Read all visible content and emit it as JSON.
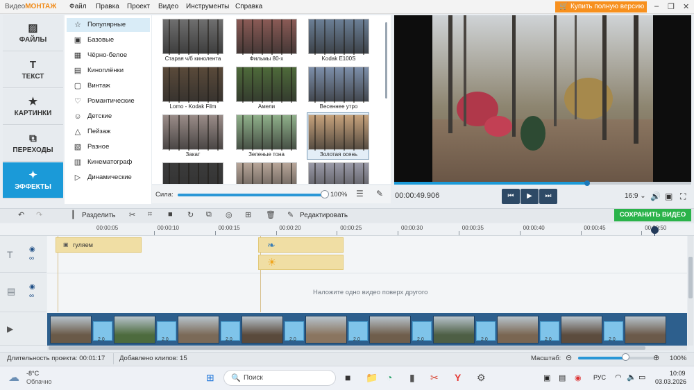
{
  "app": {
    "brand_prefix": "Видео",
    "brand_suffix": "МОНТАЖ",
    "menu": [
      "Файл",
      "Правка",
      "Проект",
      "Видео",
      "Инструменты",
      "Справка"
    ],
    "buy_label": "Купить полную версию"
  },
  "nav": [
    {
      "label": "ФАЙЛЫ",
      "icon": "image-icon",
      "active": false
    },
    {
      "label": "ТЕКСТ",
      "icon": "text-icon",
      "active": false
    },
    {
      "label": "КАРТИНКИ",
      "icon": "star-icon",
      "active": false
    },
    {
      "label": "ПЕРЕХОДЫ",
      "icon": "transition-icon",
      "active": false
    },
    {
      "label": "ЭФФЕКТЫ",
      "icon": "effects-icon",
      "active": true
    }
  ],
  "categories": [
    {
      "label": "Популярные",
      "icon": "star-icon"
    },
    {
      "label": "Базовые",
      "icon": "square-icon"
    },
    {
      "label": "Чёрно-белое",
      "icon": "grid-icon"
    },
    {
      "label": "Киноплёнки",
      "icon": "film-icon"
    },
    {
      "label": "Винтаж",
      "icon": "camera-icon"
    },
    {
      "label": "Романтические",
      "icon": "heart-icon"
    },
    {
      "label": "Детские",
      "icon": "bear-icon"
    },
    {
      "label": "Пейзаж",
      "icon": "mountain-icon"
    },
    {
      "label": "Разное",
      "icon": "blocks-icon"
    },
    {
      "label": "Кинематограф",
      "icon": "clapper-icon"
    },
    {
      "label": "Динамические",
      "icon": "play-circle-icon"
    }
  ],
  "selected_category": "Популярные",
  "filters": [
    {
      "label": "Старая ч/б кинолента",
      "tone": "#6f6f6f"
    },
    {
      "label": "Фильмы 80-х",
      "tone": "#8a5a55"
    },
    {
      "label": "Kodak E100S",
      "tone": "#6b7f96"
    },
    {
      "label": "Lomo - Kodak Film",
      "tone": "#5a4a3a"
    },
    {
      "label": "Амели",
      "tone": "#4e6a3a"
    },
    {
      "label": "Весеннее утро",
      "tone": "#7d8faa"
    },
    {
      "label": "Закат",
      "tone": "#9a8c88"
    },
    {
      "label": "Зеленые тона",
      "tone": "#8fb08a"
    },
    {
      "label": "Золотая осень",
      "tone": "#c6a27c"
    },
    {
      "label": "",
      "tone": "#3c3c3c"
    },
    {
      "label": "",
      "tone": "#b7a598"
    },
    {
      "label": "",
      "tone": "#9a9aa8"
    }
  ],
  "selected_filter": "Золотая осень",
  "strength": {
    "label": "Сила:",
    "value": "100%",
    "fraction": 1.0
  },
  "player": {
    "timecode": "00:00:49.906",
    "aspect": "16:9",
    "progress_fraction": 0.65
  },
  "toolbar": {
    "split_label": "Разделить",
    "edit_label": "Редактировать",
    "save_label": "СОХРАНИТЬ ВИДЕО"
  },
  "ruler_ticks": [
    "00:00:05",
    "00:00:10",
    "00:00:15",
    "00:00:20",
    "00:00:25",
    "00:00:30",
    "00:00:35",
    "00:00:40",
    "00:00:45",
    "00:00:50"
  ],
  "timeline": {
    "text_clip_label": "гуляем",
    "drop_hint": "Наложите одно видео поверх другого",
    "transition_duration": "2.0"
  },
  "status": {
    "duration_label": "Длительность проекта:",
    "duration_value": "00:01:17",
    "clips_label": "Добавлено клипов:",
    "clips_value": "15",
    "zoom_label": "Масштаб:",
    "zoom_value": "100%",
    "zoom_fraction": 0.62
  },
  "taskbar": {
    "temperature": "-8°C",
    "weather": "Облачно",
    "search_placeholder": "Поиск",
    "language": "РУС",
    "time": "10:09",
    "date": "03.03.2026"
  },
  "colors": {
    "accent": "#1b9ad8",
    "buy": "#f7901e",
    "save": "#2ab34a",
    "track": "#2d5f8d",
    "text_clip": "#f0dea4"
  }
}
